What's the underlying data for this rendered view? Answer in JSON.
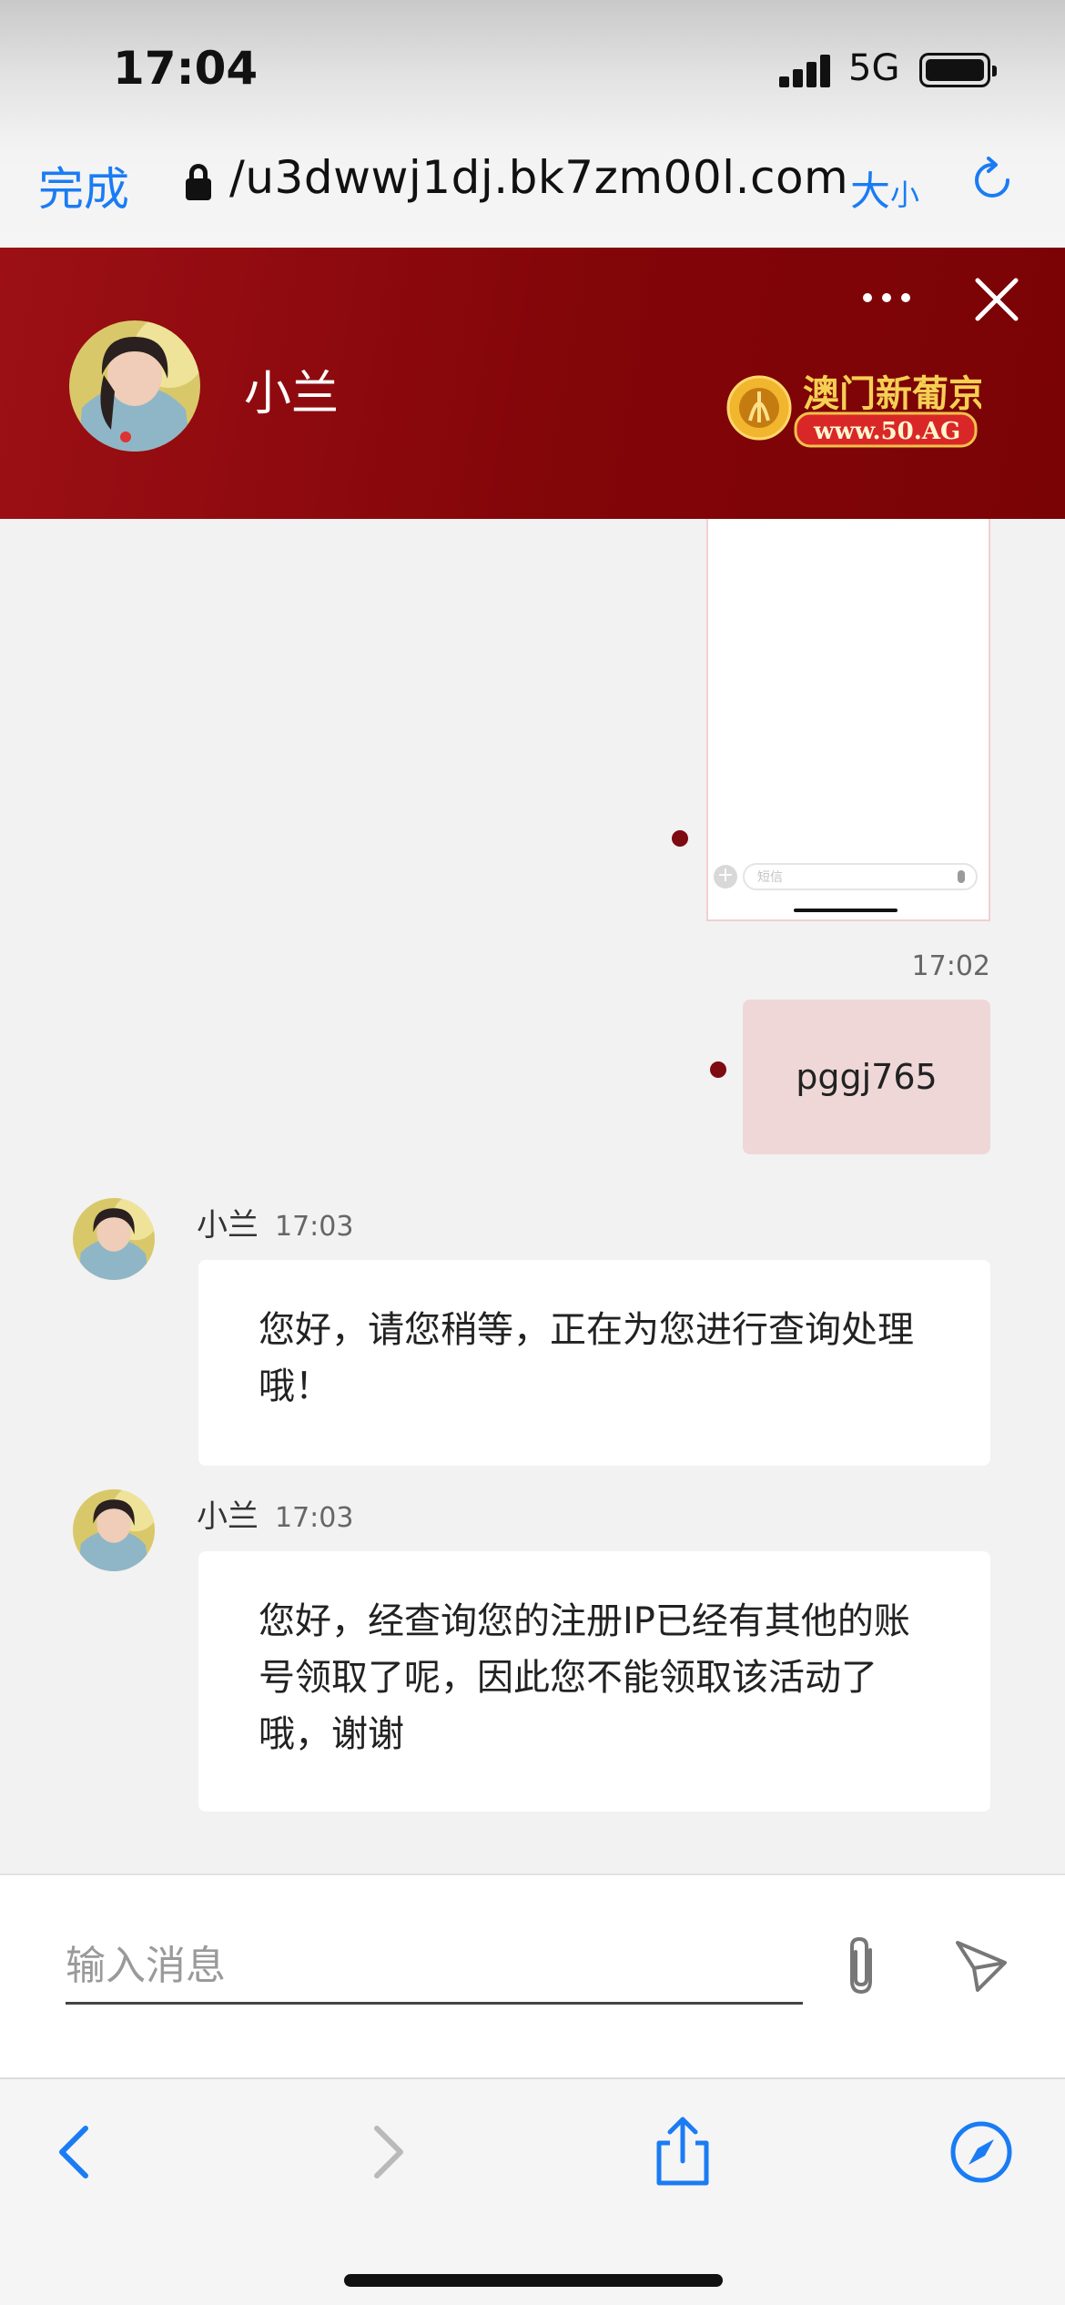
{
  "status_bar": {
    "time": "17:04",
    "network": "5G"
  },
  "browser": {
    "done_label": "完成",
    "url": "/u3dwwj1dj.bk7zm00l.com",
    "text_size_big": "大",
    "text_size_small": "小"
  },
  "chat_header": {
    "agent_name": "小兰",
    "brand_name": "澳门新葡京",
    "brand_site": "www.50.AG"
  },
  "messages": {
    "image_message": {
      "input_hint": "短信"
    },
    "sent": {
      "time": "17:02",
      "text": "pggj765"
    },
    "received": [
      {
        "sender": "小兰",
        "time": "17:03",
        "text": "您好，请您稍等，正在为您进行查询处理哦！"
      },
      {
        "sender": "小兰",
        "time": "17:03",
        "text": "您好，经查询您的注册IP已经有其他的账号领取了呢，因此您不能领取该活动了哦，谢谢"
      }
    ]
  },
  "composer": {
    "placeholder": "输入消息",
    "value": ""
  },
  "colors": {
    "header_red": "#820508",
    "accent_blue": "#1a7cf4",
    "sent_bubble": "#efd7d8",
    "unread_dot": "#7d0b11"
  },
  "icons": [
    "lock-icon",
    "reload-icon",
    "more-icon",
    "close-icon",
    "attach-icon",
    "send-icon",
    "back-icon",
    "forward-icon",
    "share-icon",
    "compass-icon"
  ]
}
